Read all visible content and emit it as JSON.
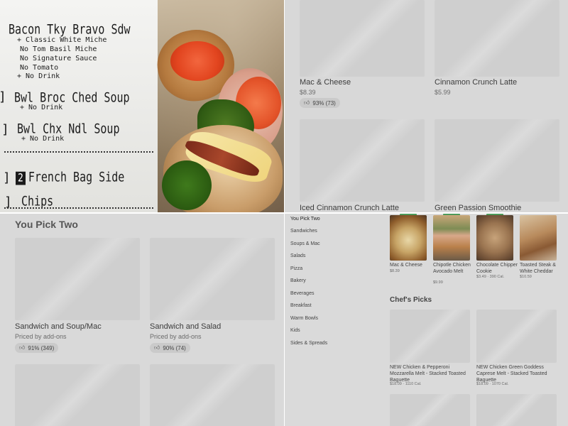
{
  "photo": {
    "receipt_lines": [
      {
        "text": "Bacon Tky Bravo Sdw",
        "style": "big"
      },
      {
        "text": "+ Classic White Miche",
        "style": "small"
      },
      {
        "text": "No Tom Basil Miche",
        "style": "small"
      },
      {
        "text": "No Signature Sauce",
        "style": "small"
      },
      {
        "text": "No Tomato",
        "style": "small"
      },
      {
        "text": "+ No Drink",
        "style": "small"
      },
      {
        "text": "Bwl Broc Ched Soup",
        "style": "big"
      },
      {
        "text": "+ No Drink",
        "style": "small"
      },
      {
        "text": "Bwl Chx Ndl Soup",
        "style": "big"
      },
      {
        "text": "+ No Drink",
        "style": "small"
      },
      {
        "text": "French Bag Side",
        "style": "big"
      },
      {
        "text": "Chips",
        "style": "big"
      }
    ],
    "qty_badge": "2"
  },
  "top_right": {
    "items": [
      {
        "name": "Mac & Cheese",
        "price": "$8.39",
        "rating": "93% (73)"
      },
      {
        "name": "Cinnamon Crunch Latte",
        "price": "$5.99",
        "rating": ""
      },
      {
        "name": "Iced Cinnamon Crunch Latte",
        "price": "",
        "rating": ""
      },
      {
        "name": "Green Passion Smoothie",
        "price": "",
        "rating": ""
      }
    ]
  },
  "bottom_left": {
    "section_title": "You Pick Two",
    "items": [
      {
        "name": "Sandwich and Soup/Mac",
        "sub": "Priced by add-ons",
        "rating": "91% (349)"
      },
      {
        "name": "Sandwich and Salad",
        "sub": "Priced by add-ons",
        "rating": "90% (74)"
      }
    ]
  },
  "bottom_right": {
    "categories": [
      "You Pick Two",
      "Sandwiches",
      "Soups & Mac",
      "Salads",
      "Pizza",
      "Bakery",
      "Beverages",
      "Breakfast",
      "Warm Bowls",
      "Kids",
      "Sides & Spreads"
    ],
    "top_items": [
      {
        "name": "Mac & Cheese",
        "price": "$8.39",
        "cal": ""
      },
      {
        "name": "Chipotle Chicken Avocado Melt",
        "price": "$9.99",
        "cal": ""
      },
      {
        "name": "Chocolate Chipper Cookie",
        "price": "$3.49",
        "cal": "390 Cal."
      },
      {
        "name": "Toasted Steak & White Cheddar",
        "price": "$10.59",
        "cal": ""
      }
    ],
    "chefs_title": "Chef's Picks",
    "chef_items": [
      {
        "name": "NEW Chicken & Pepperoni Mozzarella Melt - Stacked Toasted Baguette",
        "price": "$18.09",
        "cal": "1110 Cal."
      },
      {
        "name": "NEW Chicken Green Goddess Caprese Melt - Stacked Toasted Baguette",
        "price": "$18.09",
        "cal": "1070 Cal."
      }
    ],
    "accent_color": "#4d9a5a"
  }
}
